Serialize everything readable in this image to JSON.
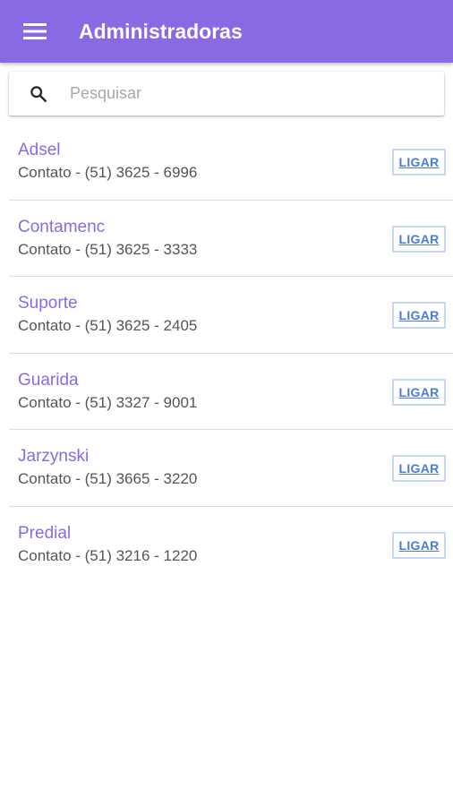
{
  "colors": {
    "appbar": "#8a6ae4",
    "accent_text": "#8a6ae4",
    "button_text": "#4a79e0",
    "button_border": "#c8d7f6",
    "divider": "#dcdcdc"
  },
  "appbar": {
    "menu_icon": "hamburger-menu-icon",
    "title": "Administradoras"
  },
  "search": {
    "icon": "search-icon",
    "placeholder": "Pesquisar",
    "value": ""
  },
  "contacts": [
    {
      "name": "Adsel",
      "contact": "Contato - (51) 3625 - 6996",
      "button_label": "LIGAR"
    },
    {
      "name": "Contamenc",
      "contact": "Contato - (51) 3625 - 3333",
      "button_label": "LIGAR"
    },
    {
      "name": "Suporte",
      "contact": "Contato - (51) 3625 - 2405",
      "button_label": "LIGAR"
    },
    {
      "name": "Guarida",
      "contact": "Contato - (51) 3327 - 9001",
      "button_label": "LIGAR"
    },
    {
      "name": "Jarzynski",
      "contact": "Contato - (51) 3665 - 3220",
      "button_label": "LIGAR"
    },
    {
      "name": "Predial",
      "contact": "Contato - (51) 3216 - 1220",
      "button_label": "LIGAR"
    }
  ]
}
